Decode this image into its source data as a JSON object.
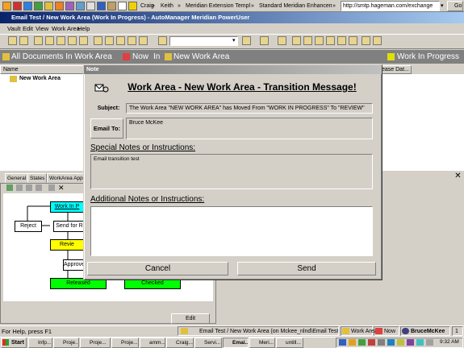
{
  "links_bar": {
    "items": [
      "Email Test / New Work Area (Work In Progress) - AutoManager Meridian PowerUser",
      "Craig",
      "Keith",
      "Meridian Extension Templates",
      "Standard Meridian Enhancements"
    ],
    "address": "http://smtp.hageman.com/exchange",
    "go_label": "Go"
  },
  "window": {
    "title": "Email Test / New Work Area (Work In Progress) - AutoManager Meridian PowerUser"
  },
  "menubar": {
    "items": [
      "Vault",
      "Edit",
      "View",
      "Work Area",
      "Help"
    ]
  },
  "path_bar": {
    "root": "All Documents In Work Area",
    "now_label": "Now",
    "in_label": "In",
    "area": "New Work Area",
    "state": "Work In Progress"
  },
  "list": {
    "col_name": "Name",
    "col_date": "ease Dat...",
    "rows": [
      {
        "name": "New Work Area"
      }
    ]
  },
  "bottom_tabs": [
    "General",
    "States",
    "WorkArea Appr..."
  ],
  "diagram": {
    "nodes": [
      "Work In P",
      "Reject",
      "Send for R",
      "Revie",
      "Approve",
      "Released",
      "Checked"
    ]
  },
  "edit_button": "Edit",
  "status": {
    "left": "For Help, press F1",
    "middle": "Email Test / New Work Area (on Mckee_nlnd\\Email Test)",
    "work_area": "Work Area",
    "now": "Now",
    "user": "BruceMcKee",
    "count": "1"
  },
  "taskbar": {
    "start": "Start",
    "tasks": [
      "Infp...",
      "Proje...",
      "Proje...",
      "Proje...",
      "amm...",
      "Craig...",
      "Servi...",
      "Emai...",
      "Meri...",
      "untill..."
    ],
    "clock": "9:32 AM"
  },
  "dialog": {
    "title": "Note",
    "heading": "Work Area - New Work Area - Transition Message!",
    "subject_label": "Subject:",
    "subject_value": "The Work Area \"NEW WORK AREA\" has Moved From \"WORK IN PROGRESS\" To \"REVIEW\"",
    "email_to_label": "Email To:",
    "email_to_value": "Bruce McKee",
    "special_header": "Special Notes or Instructions:",
    "special_value": "Email transition test",
    "additional_header": "Additional Notes or Instructions:",
    "additional_value": "",
    "cancel_label": "Cancel",
    "send_label": "Send"
  },
  "colors": {
    "title_active": "#0a246a",
    "title_inactive": "#808080",
    "face": "#d4d0c8",
    "node_cyan": "#00ffff",
    "node_yellow": "#ffff00",
    "node_green": "#00ff00"
  }
}
